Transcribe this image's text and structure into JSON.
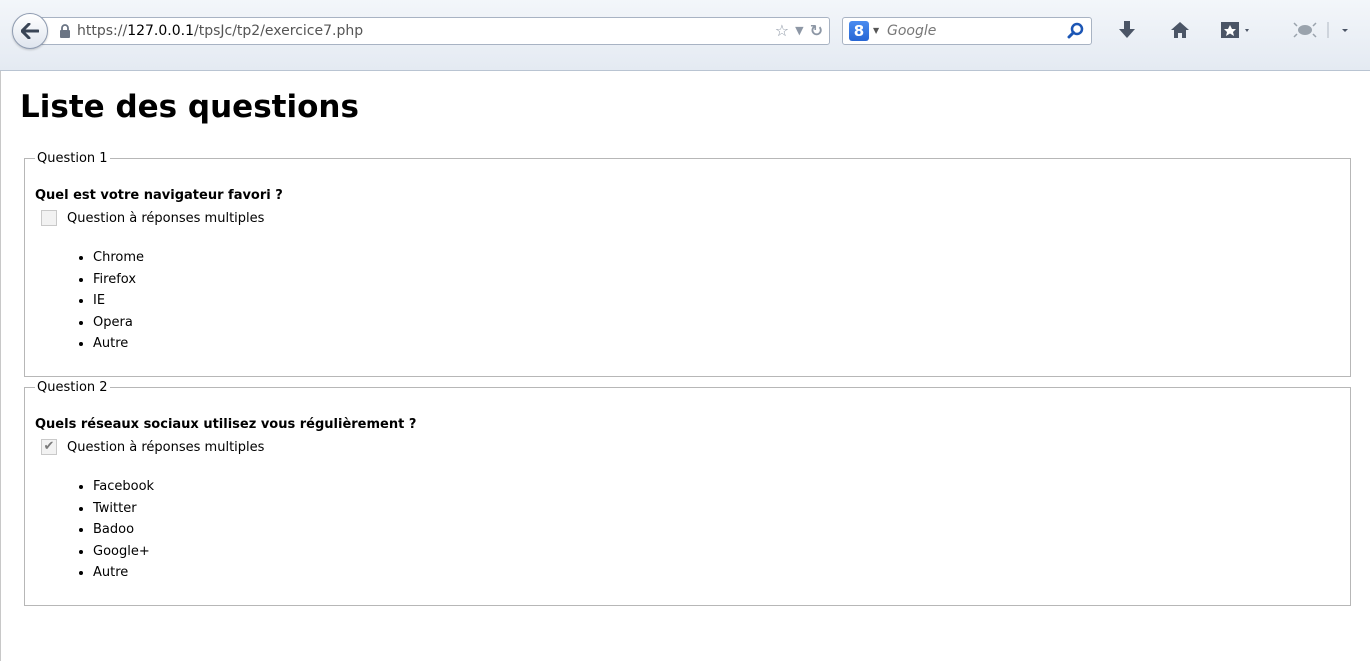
{
  "browser": {
    "url_prefix": "https://",
    "url_host": "127.0.0.1",
    "url_path": "/tpsJc/tp2/exercice7.php",
    "search_placeholder": "Google",
    "search_engine_badge": "8"
  },
  "page": {
    "title": "Liste des questions"
  },
  "questions": [
    {
      "legend": "Question 1",
      "text": "Quel est votre navigateur favori ?",
      "multi_label": "Question à réponses multiples",
      "multi_checked": false,
      "answers": [
        "Chrome",
        "Firefox",
        "IE",
        "Opera",
        "Autre"
      ]
    },
    {
      "legend": "Question 2",
      "text": "Quels réseaux sociaux utilisez vous régulièrement ?",
      "multi_label": "Question à réponses multiples",
      "multi_checked": true,
      "answers": [
        "Facebook",
        "Twitter",
        "Badoo",
        "Google+",
        "Autre"
      ]
    }
  ],
  "icons": {
    "back": "back-arrow-icon",
    "lock": "lock-icon",
    "bookmark_star": "star-icon",
    "history_dropdown": "triangle-down-icon",
    "reload": "reload-icon",
    "search_go": "magnifier-icon",
    "downloads": "download-arrow-icon",
    "home": "home-icon",
    "addon": "addon-icon",
    "firebug": "bug-icon"
  }
}
